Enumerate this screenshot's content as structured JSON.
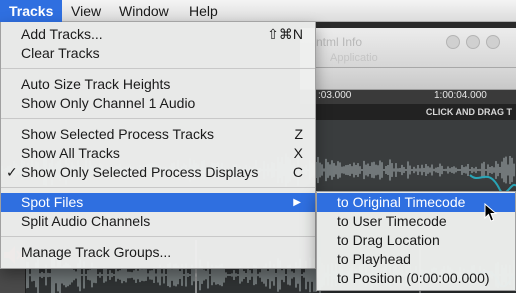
{
  "menubar": {
    "items": [
      {
        "label": "Tracks"
      },
      {
        "label": "View"
      },
      {
        "label": "Window"
      },
      {
        "label": "Help"
      }
    ]
  },
  "tracks_menu": {
    "items": [
      {
        "label": "Add Tracks...",
        "shortcut": "⇧⌘N"
      },
      {
        "label": "Clear Tracks",
        "shortcut": ""
      },
      {
        "label": "Auto Size Track Heights",
        "shortcut": ""
      },
      {
        "label": "Show Only Channel 1 Audio",
        "shortcut": ""
      },
      {
        "label": "Show Selected Process Tracks",
        "shortcut": "Z"
      },
      {
        "label": "Show All Tracks",
        "shortcut": "X"
      },
      {
        "label": "Show Only Selected Process Displays",
        "shortcut": "C",
        "checked": "✓"
      },
      {
        "label": "Spot Files",
        "arrow": "▶"
      },
      {
        "label": "Split Audio Channels",
        "shortcut": ""
      },
      {
        "label": "Manage Track Groups...",
        "shortcut": ""
      }
    ]
  },
  "spot_files_submenu": {
    "items": [
      {
        "label": "to Original Timecode"
      },
      {
        "label": "to User Timecode"
      },
      {
        "label": "to Drag Location"
      },
      {
        "label": "to Playhead"
      },
      {
        "label": "to Position (0:00:00.000)"
      }
    ]
  },
  "background_window": {
    "title": "ntml Info",
    "subtitle": "Applicatio",
    "ruler": {
      "tick_1": ":03.000",
      "tick_2": "1:00:04.000"
    },
    "hint": "CLICK AND DRAG T"
  },
  "colors": {
    "highlight": "#2f6fe0",
    "waveform": "#8a9294",
    "waveform_accent": "#2aa6b8",
    "mute_icon": "#e04040"
  }
}
